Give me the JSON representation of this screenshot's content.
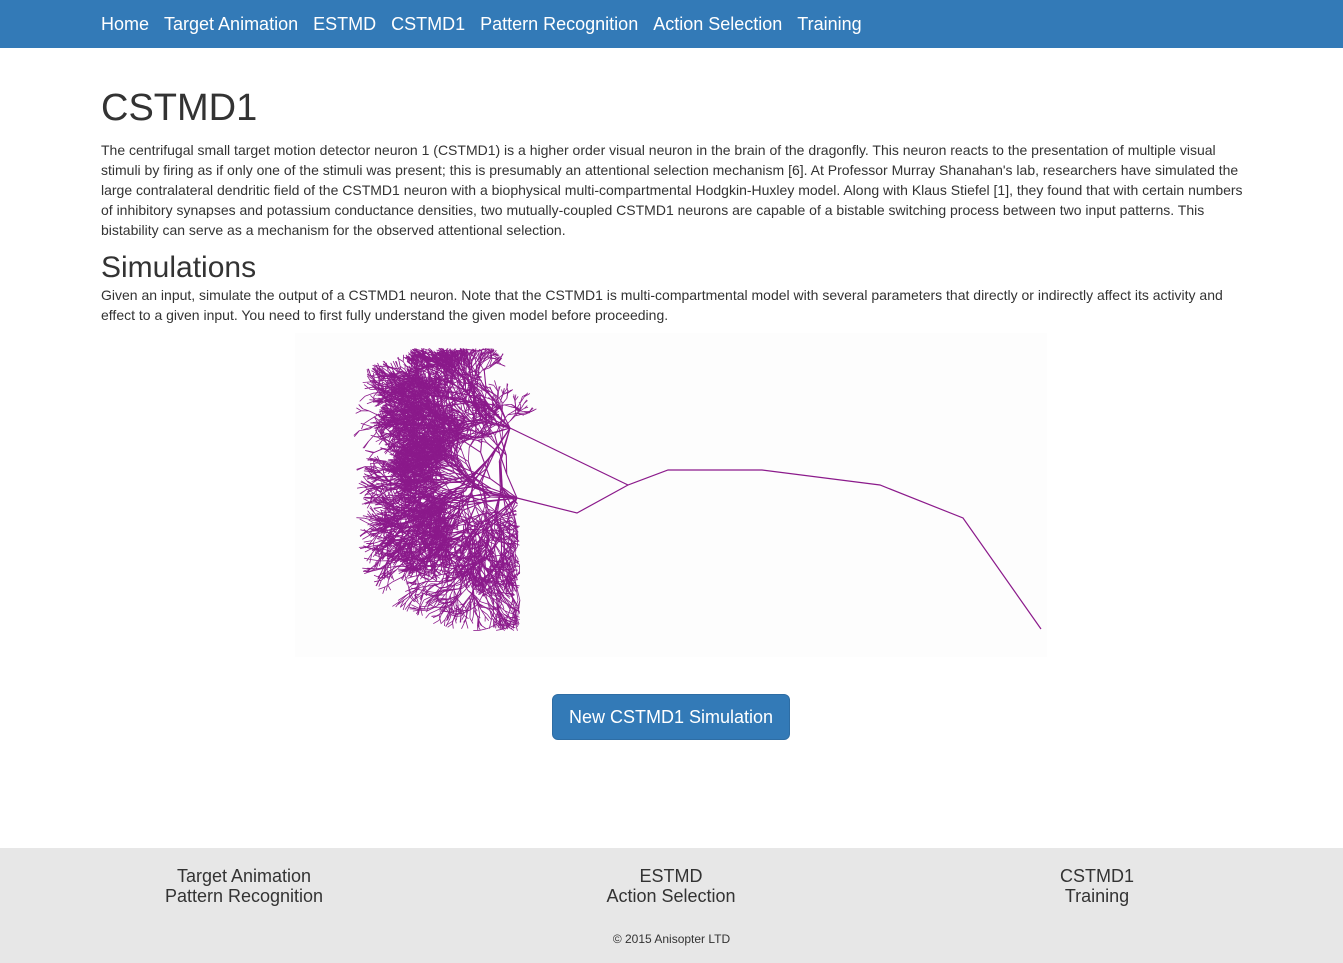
{
  "nav": {
    "items": [
      {
        "label": "Home"
      },
      {
        "label": "Target Animation"
      },
      {
        "label": "ESTMD"
      },
      {
        "label": "CSTMD1"
      },
      {
        "label": "Pattern Recognition"
      },
      {
        "label": "Action Selection"
      },
      {
        "label": "Training"
      }
    ]
  },
  "main": {
    "title": "CSTMD1",
    "intro": "The centrifugal small target motion detector neuron 1 (CSTMD1) is a higher order visual neuron in the brain of the dragonfly. This neuron reacts to the presentation of multiple visual stimuli by firing as if only one of the stimuli was present; this is presumably an attentional selection mechanism [6]. At Professor Murray Shanahan's lab, researchers have simulated the large contralateral dendritic field of the CSTMD1 neuron with a biophysical multi-compartmental Hodgkin-Huxley model. Along with Klaus Stiefel [1], they found that with certain numbers of inhibitory synapses and potassium conductance densities, two mutually-coupled CSTMD1 neurons are capable of a bistable switching process between two input patterns. This bistability can serve as a mechanism for the observed attentional selection.",
    "section_title": "Simulations",
    "section_text": "Given an input, simulate the output of a CSTMD1 neuron. Note that the CSTMD1 is multi-compartmental model with several parameters that directly or indirectly affect its activity and effect to a given input. You need to first fully understand the given model before proceeding.",
    "button_label": "New CSTMD1 Simulation"
  },
  "figure": {
    "neuron_color": "#8b1a8b"
  },
  "footer": {
    "col1": [
      "Target Animation",
      "Pattern Recognition"
    ],
    "col2": [
      "ESTMD",
      "Action Selection"
    ],
    "col3": [
      "CSTMD1",
      "Training"
    ],
    "copyright": "© 2015 Anisopter LTD"
  },
  "colors": {
    "navbar": "#337ab7",
    "footer": "#e7e7e7",
    "button": "#337ab7"
  }
}
